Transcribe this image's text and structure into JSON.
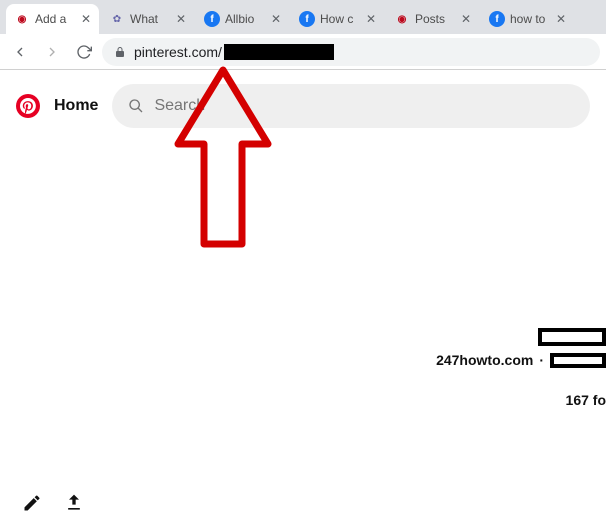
{
  "tabs": [
    {
      "title": "Add a",
      "favicon": "pin"
    },
    {
      "title": "What",
      "favicon": "gen"
    },
    {
      "title": "Allbio",
      "favicon": "fb"
    },
    {
      "title": "How c",
      "favicon": "fb"
    },
    {
      "title": "Posts",
      "favicon": "pin"
    },
    {
      "title": "how to",
      "favicon": "fb"
    }
  ],
  "url": {
    "host": "pinterest.com/"
  },
  "app": {
    "home": "Home",
    "search_placeholder": "Search"
  },
  "profile": {
    "site": "247howto.com",
    "dot": "·",
    "followers": "167 fo"
  }
}
